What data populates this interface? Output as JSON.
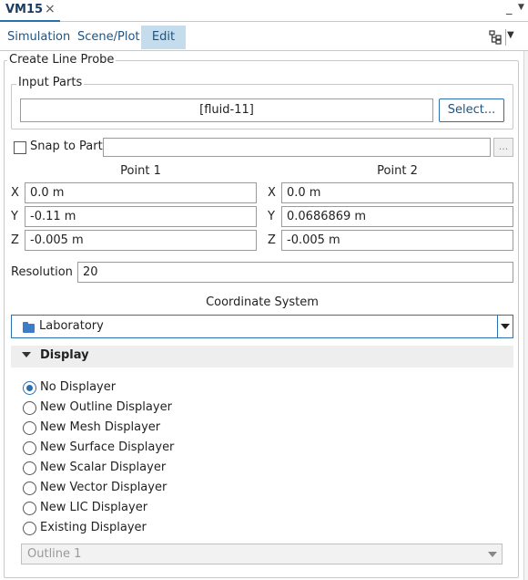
{
  "window": {
    "tab_title": "VM15",
    "close_glyph": "×",
    "minimize_glyph": "_",
    "dropdown_glyph": "▼"
  },
  "menu": {
    "items": [
      "Simulation",
      "Scene/Plot",
      "Edit"
    ],
    "active": "Edit",
    "dropdown_glyph": "▼"
  },
  "panel": {
    "title": "Create Line Probe",
    "input_parts": {
      "legend": "Input Parts",
      "value": "[fluid-11]",
      "select_button": "Select..."
    },
    "snap_to_part": {
      "label": "Snap to Part",
      "checked": false,
      "value": "",
      "browse_button": "..."
    },
    "point1": {
      "header": "Point 1",
      "x": "0.0 m",
      "y": "-0.11 m",
      "z": "-0.005 m"
    },
    "point2": {
      "header": "Point 2",
      "x": "0.0 m",
      "y": "0.0686869 m",
      "z": "-0.005 m"
    },
    "axis_labels": {
      "x": "X",
      "y": "Y",
      "z": "Z"
    },
    "resolution": {
      "label": "Resolution",
      "value": "20"
    },
    "coordinate_system": {
      "label": "Coordinate System",
      "value": "Laboratory",
      "icon": "folder-icon"
    },
    "display": {
      "title": "Display",
      "options": [
        "No Displayer",
        "New Outline Displayer",
        "New Mesh Displayer",
        "New Surface Displayer",
        "New Scalar Displayer",
        "New Vector Displayer",
        "New LIC Displayer",
        "Existing Displayer"
      ],
      "selected": "No Displayer",
      "existing_displayer_value": "Outline 1"
    }
  },
  "colors": {
    "accent": "#2a6fb0",
    "menu_text": "#1e5482",
    "active_menu_bg": "#c4dcec"
  }
}
